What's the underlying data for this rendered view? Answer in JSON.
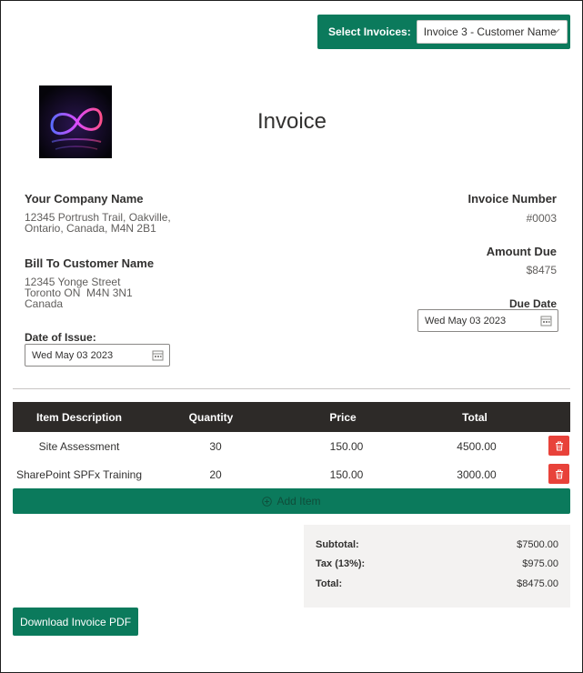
{
  "header": {
    "select_label": "Select Invoices:",
    "select_value": "Invoice 3 - Customer Name"
  },
  "invoice": {
    "title": "Invoice",
    "company_name": "Your Company Name",
    "company_address_line1": "12345 Portrush Trail, Oakville,",
    "company_address_line2": "Ontario, Canada, M4N 2B1",
    "invoice_number_label": "Invoice Number",
    "invoice_number": "#0003",
    "amount_due_label": "Amount Due",
    "amount_due": "$8475",
    "bill_to_name": "Bill To Customer Name",
    "bill_to_line1": "12345 Yonge Street",
    "bill_to_line2": "Toronto ON  M4N 3N1",
    "bill_to_line3": "Canada",
    "due_date_label": "Due Date",
    "due_date": "Wed May 03 2023",
    "issue_date_label": "Date of Issue:",
    "issue_date": "Wed May 03 2023"
  },
  "table": {
    "columns": [
      "Item Description",
      "Quantity",
      "Price",
      "Total"
    ],
    "rows": [
      {
        "description": "Site Assessment",
        "quantity": "30",
        "price": "150.00",
        "total": "4500.00"
      },
      {
        "description": "SharePoint SPFx Training",
        "quantity": "20",
        "price": "150.00",
        "total": "3000.00"
      }
    ],
    "add_item_label": "Add Item"
  },
  "totals": {
    "subtotal_label": "Subtotal:",
    "subtotal": "$7500.00",
    "tax_label": "Tax (13%):",
    "tax": "$975.00",
    "total_label": "Total:",
    "total": "$8475.00"
  },
  "actions": {
    "download_label": "Download Invoice PDF"
  },
  "icons": {
    "select_chevron": "chevron-down-icon",
    "calendar": "calendar-icon",
    "delete": "trash-icon",
    "add": "add-circle-icon"
  },
  "colors": {
    "accent": "#0b7a5c",
    "table_header": "#2d2a28",
    "delete": "#e8423a",
    "totals_bg": "#f3f2f1"
  }
}
